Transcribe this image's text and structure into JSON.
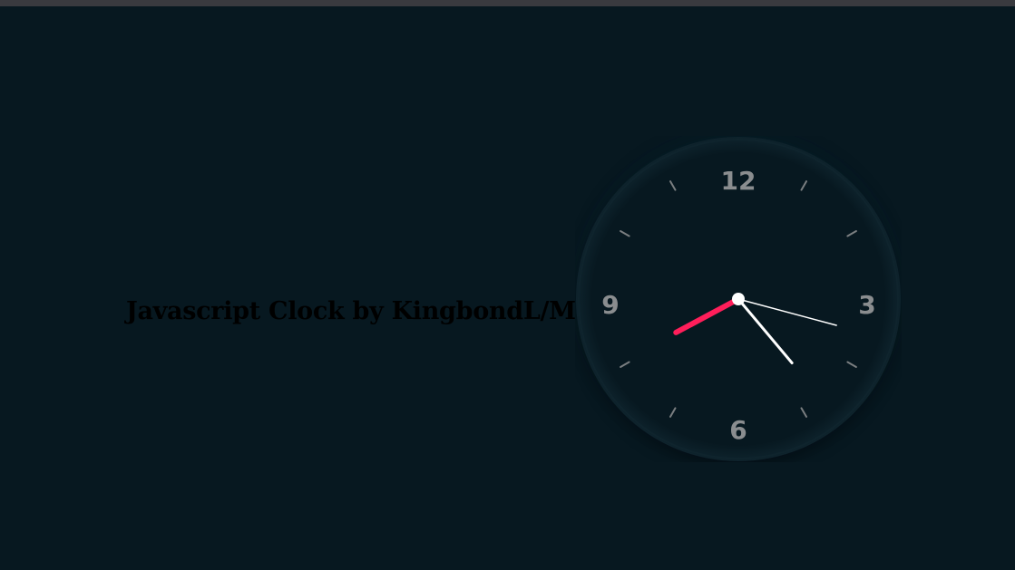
{
  "browser": {
    "chrome_color": "#393a3f"
  },
  "page": {
    "title": "Javascript Clock by KingbondL/MS",
    "background": "#071820"
  },
  "clock": {
    "numerals": {
      "twelve": "12",
      "three": "3",
      "six": "6",
      "nine": "9"
    },
    "time": {
      "hours": 4,
      "minutes": 40,
      "seconds": 17.5
    },
    "colors": {
      "face": "#071820",
      "numeral": "#8a8d8f",
      "tick": "#7a7e80",
      "hour_hand": "#ffffff",
      "minute_hand": "#ff1e5a",
      "second_hand": "#ffffff",
      "center": "#ffffff"
    }
  }
}
